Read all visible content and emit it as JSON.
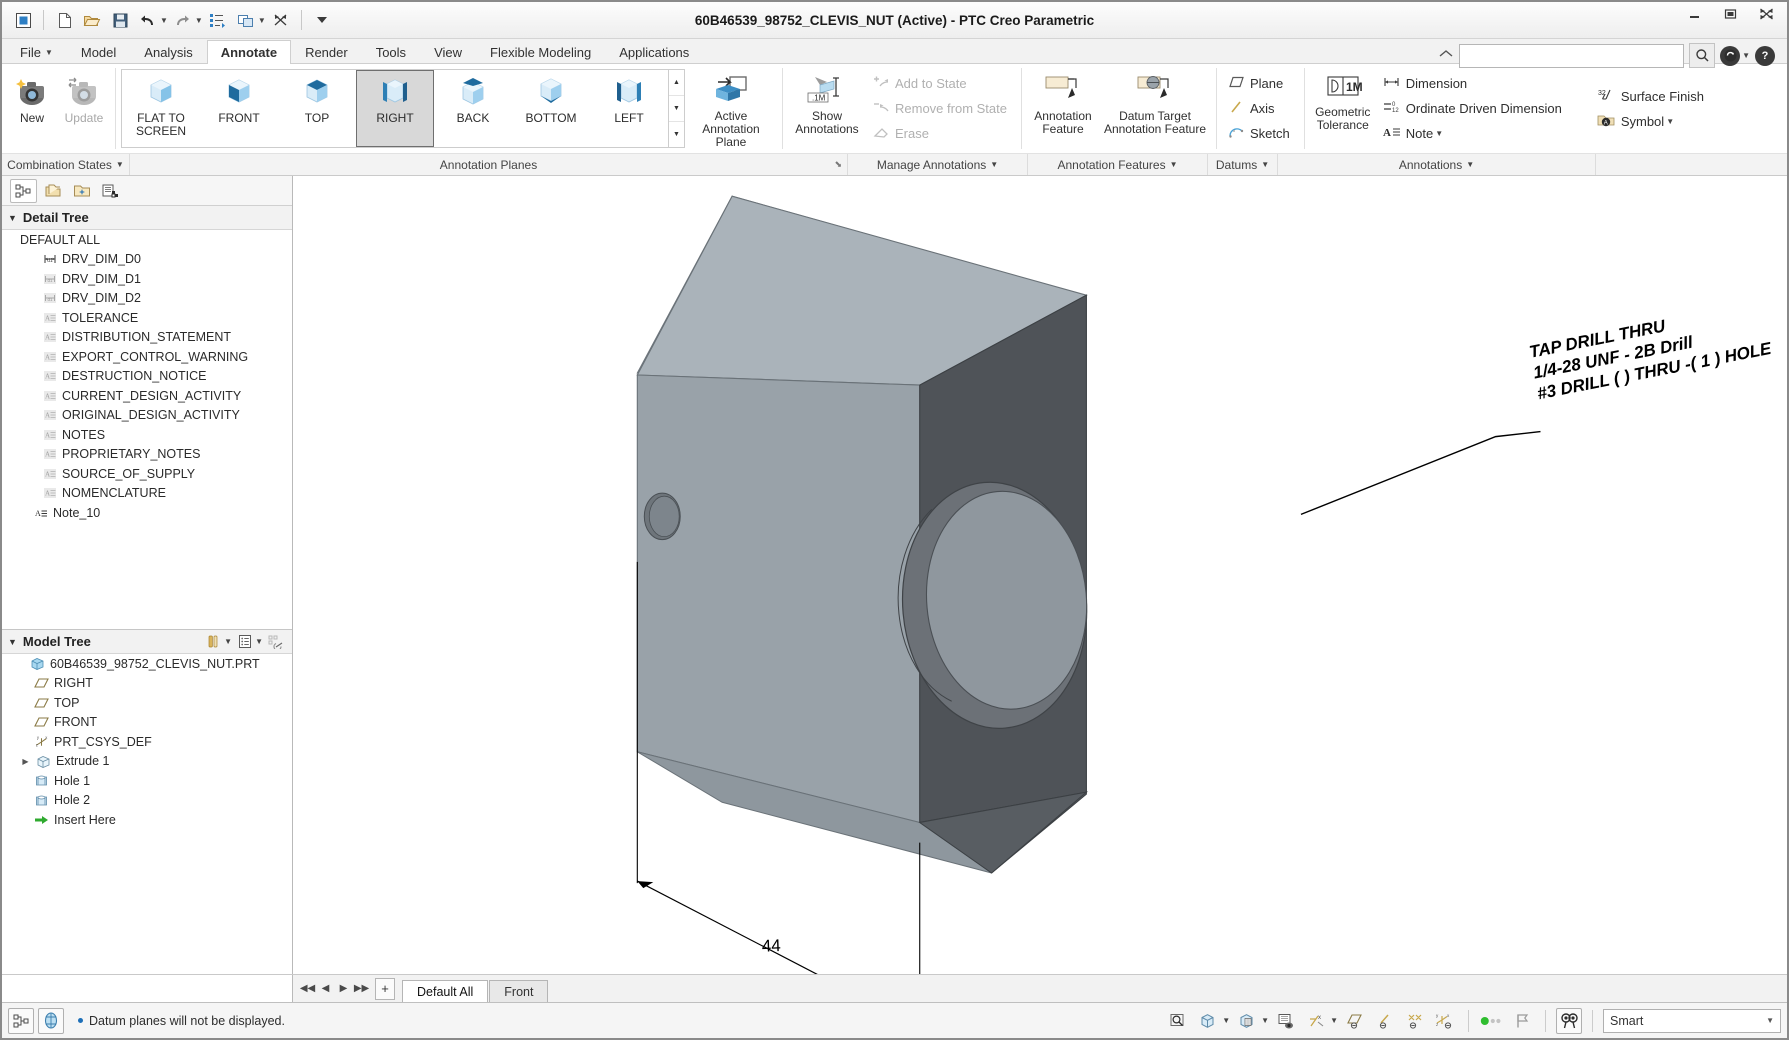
{
  "window": {
    "title": "60B46539_98752_CLEVIS_NUT (Active) - PTC Creo Parametric",
    "minimize": "—",
    "restore": "❐",
    "close": "✕"
  },
  "quick_access": {
    "items": [
      {
        "name": "new-window-icon",
        "label": ""
      },
      {
        "name": "new-file-icon",
        "label": ""
      },
      {
        "name": "open-file-icon",
        "label": ""
      },
      {
        "name": "save-icon",
        "label": ""
      },
      {
        "name": "undo-icon",
        "label": ""
      },
      {
        "name": "redo-icon",
        "label": ""
      },
      {
        "name": "regenerate-icon",
        "label": ""
      },
      {
        "name": "window-switch-icon",
        "label": ""
      },
      {
        "name": "close-window-icon",
        "label": ""
      },
      {
        "name": "customize-qat-icon",
        "label": ""
      }
    ]
  },
  "search": {
    "value": "",
    "placeholder": ""
  },
  "ribbon_tabs": [
    {
      "label": "File",
      "has_caret": true,
      "active": false
    },
    {
      "label": "Model",
      "active": false
    },
    {
      "label": "Analysis",
      "active": false
    },
    {
      "label": "Annotate",
      "active": true
    },
    {
      "label": "Render",
      "active": false
    },
    {
      "label": "Tools",
      "active": false
    },
    {
      "label": "View",
      "active": false
    },
    {
      "label": "Flexible Modeling",
      "active": false
    },
    {
      "label": "Applications",
      "active": false
    }
  ],
  "ribbon": {
    "combination_states": {
      "caption": "Combination States",
      "buttons": [
        {
          "label": "New",
          "enabled": true
        },
        {
          "label": "Update",
          "enabled": false
        }
      ]
    },
    "annotation_planes": {
      "caption": "Annotation Planes",
      "planes": [
        {
          "label": "FLAT TO SCREEN",
          "selected": false
        },
        {
          "label": "FRONT",
          "selected": false
        },
        {
          "label": "TOP",
          "selected": false
        },
        {
          "label": "RIGHT",
          "selected": true
        },
        {
          "label": "BACK",
          "selected": false
        },
        {
          "label": "BOTTOM",
          "selected": false
        },
        {
          "label": "LEFT",
          "selected": false
        }
      ],
      "active_annotation_plane": "Active Annotation Plane"
    },
    "manage_annotations": {
      "caption": "Manage Annotations",
      "show_annotations": "Show Annotations",
      "items": [
        {
          "label": "Add to State",
          "enabled": false
        },
        {
          "label": "Remove from State",
          "enabled": false
        },
        {
          "label": "Erase",
          "enabled": false
        }
      ]
    },
    "annotation_features": {
      "caption": "Annotation Features",
      "items": [
        {
          "label": "Annotation Feature"
        },
        {
          "label": "Datum Target Annotation Feature"
        }
      ]
    },
    "datums": {
      "caption": "Datums",
      "items": [
        {
          "label": "Plane"
        },
        {
          "label": "Axis"
        },
        {
          "label": "Sketch"
        }
      ]
    },
    "annotations": {
      "caption": "Annotations",
      "geometric_tolerance": "Geometric Tolerance",
      "items": [
        {
          "label": "Dimension"
        },
        {
          "label": "Ordinate Driven Dimension"
        },
        {
          "label": "Note",
          "has_caret": true
        },
        {
          "label": "Surface Finish"
        },
        {
          "label": "Symbol",
          "has_caret": true
        }
      ]
    }
  },
  "left_pane": {
    "nav_tabs": [
      {
        "name": "model-tree-tab",
        "active": true
      },
      {
        "name": "folder-browser-tab",
        "active": false
      },
      {
        "name": "favorites-tab",
        "active": false
      },
      {
        "name": "layer-tree-tab",
        "active": false
      }
    ],
    "detail_tree": {
      "title": "Detail Tree",
      "root": "DEFAULT ALL",
      "items": [
        {
          "label": "DRV_DIM_D0",
          "icon": "dimension-icon",
          "indent": 1,
          "active": true
        },
        {
          "label": "DRV_DIM_D1",
          "icon": "dimension-icon",
          "indent": 1,
          "active": false
        },
        {
          "label": "DRV_DIM_D2",
          "icon": "dimension-icon",
          "indent": 1,
          "active": false
        },
        {
          "label": "TOLERANCE",
          "icon": "note-icon",
          "indent": 1,
          "active": false
        },
        {
          "label": "DISTRIBUTION_STATEMENT",
          "icon": "note-icon",
          "indent": 1,
          "active": false
        },
        {
          "label": "EXPORT_CONTROL_WARNING",
          "icon": "note-icon",
          "indent": 1,
          "active": false
        },
        {
          "label": "DESTRUCTION_NOTICE",
          "icon": "note-icon",
          "indent": 1,
          "active": false
        },
        {
          "label": "CURRENT_DESIGN_ACTIVITY",
          "icon": "note-icon",
          "indent": 1,
          "active": false
        },
        {
          "label": "ORIGINAL_DESIGN_ACTIVITY",
          "icon": "note-icon",
          "indent": 1,
          "active": false
        },
        {
          "label": "NOTES",
          "icon": "note-icon",
          "indent": 1,
          "active": false
        },
        {
          "label": "PROPRIETARY_NOTES",
          "icon": "note-icon",
          "indent": 1,
          "active": false
        },
        {
          "label": "SOURCE_OF_SUPPLY",
          "icon": "note-icon",
          "indent": 1,
          "active": false
        },
        {
          "label": "NOMENCLATURE",
          "icon": "note-icon",
          "indent": 1,
          "active": false
        },
        {
          "label": "Note_10",
          "icon": "note-icon",
          "indent": 0,
          "active": true
        }
      ]
    },
    "model_tree": {
      "title": "Model Tree",
      "items": [
        {
          "label": "60B46539_98752_CLEVIS_NUT.PRT",
          "icon": "part-icon",
          "indent": 0,
          "expander": false
        },
        {
          "label": "RIGHT",
          "icon": "datum-plane-icon",
          "indent": 1,
          "expander": false
        },
        {
          "label": "TOP",
          "icon": "datum-plane-icon",
          "indent": 1,
          "expander": false
        },
        {
          "label": "FRONT",
          "icon": "datum-plane-icon",
          "indent": 1,
          "expander": false
        },
        {
          "label": "PRT_CSYS_DEF",
          "icon": "coordinate-system-icon",
          "indent": 1,
          "expander": false
        },
        {
          "label": "Extrude 1",
          "icon": "extrude-icon",
          "indent": 1,
          "expander": true
        },
        {
          "label": "Hole 1",
          "icon": "hole-icon",
          "indent": 1,
          "expander": false
        },
        {
          "label": "Hole 2",
          "icon": "hole-icon",
          "indent": 1,
          "expander": false
        },
        {
          "label": "Insert Here",
          "icon": "insert-here-icon",
          "indent": 1,
          "expander": false
        }
      ]
    }
  },
  "graphics": {
    "annotation_note": {
      "line1": "TAP DRILL THRU",
      "line2": "1/4-28 UNF - 2B Drill",
      "line3": "#3 DRILL (   )  THRU  -( 1 ) HOLE"
    },
    "dimension_value": "44"
  },
  "view_tabs": {
    "nav": [
      {
        "name": "first-view-button",
        "glyph": "◀◀"
      },
      {
        "name": "prev-view-button",
        "glyph": "◀"
      },
      {
        "name": "next-view-button",
        "glyph": "▶"
      },
      {
        "name": "last-view-button",
        "glyph": "▶▶"
      }
    ],
    "add_label": "+",
    "tabs": [
      {
        "label": "Default All",
        "active": true
      },
      {
        "label": "Front",
        "active": false
      }
    ]
  },
  "status_bar": {
    "message": "Datum planes will not be displayed.",
    "selection_filter": "Smart",
    "right_tools": [
      {
        "name": "zoom-in-icon"
      },
      {
        "name": "display-style-icon"
      },
      {
        "name": "saved-orientations-icon"
      },
      {
        "name": "scene-icon"
      },
      {
        "name": "datum-display-filters-icon"
      },
      {
        "name": "plane-display-icon"
      },
      {
        "name": "axis-display-icon"
      },
      {
        "name": "point-display-icon"
      },
      {
        "name": "csys-display-icon"
      },
      {
        "name": "annotation-display-icon"
      },
      {
        "name": "flag-icon"
      },
      {
        "name": "search-tool-icon"
      }
    ]
  },
  "colors": {
    "accent": "#1d6fb8",
    "model_light": "#9aa3ab",
    "model_top": "#a7b0b8",
    "model_dark": "#5c6166",
    "model_mid": "#8d969e",
    "selected_plane_bg": "#d8d8d8"
  }
}
